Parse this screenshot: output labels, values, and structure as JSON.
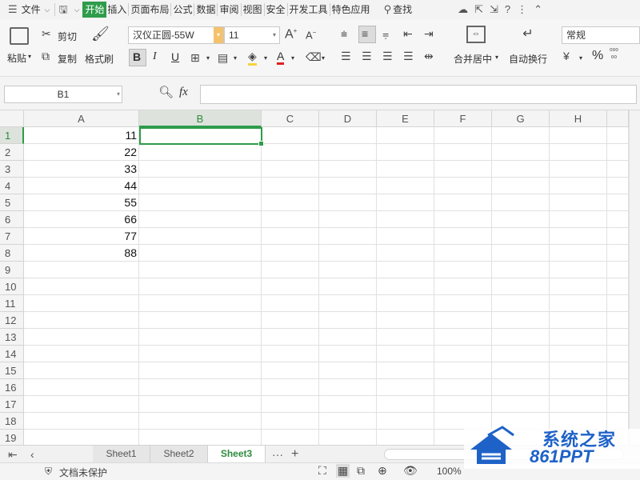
{
  "menu": {
    "file": "文件",
    "tabs": [
      "开始",
      "插入",
      "页面布局",
      "公式",
      "数据",
      "审阅",
      "视图",
      "安全",
      "开发工具",
      "特色应用"
    ],
    "active_tab": "开始",
    "search": "查找"
  },
  "ribbon": {
    "paste": "粘贴",
    "cut": "剪切",
    "copy": "复制",
    "format_painter": "格式刷",
    "font_name": "汉仪正圆-55W",
    "font_size": "11",
    "merge_center": "合并居中",
    "auto_wrap": "自动换行",
    "number_format": "常规",
    "percent": "%",
    "bold": "B",
    "italic": "I",
    "underline": "U",
    "font_color_glyph": "A"
  },
  "formula_bar": {
    "name_box": "B1",
    "fx": "fx",
    "value": ""
  },
  "grid": {
    "columns": [
      "A",
      "B",
      "C",
      "D",
      "E",
      "F",
      "G",
      "H"
    ],
    "selected_column": "B",
    "selected_row": "1",
    "rows": [
      "1",
      "2",
      "3",
      "4",
      "5",
      "6",
      "7",
      "8",
      "9",
      "10",
      "11",
      "12",
      "13",
      "14",
      "15",
      "16",
      "17",
      "18",
      "19"
    ],
    "column_a_values": [
      "11",
      "22",
      "33",
      "44",
      "55",
      "66",
      "77",
      "88"
    ]
  },
  "sheets": {
    "tabs": [
      "Sheet1",
      "Sheet2",
      "Sheet3"
    ],
    "active": "Sheet3",
    "more": "···",
    "add": "+"
  },
  "status": {
    "protect": "文档未保护",
    "zoom": "100%"
  },
  "watermark": {
    "title": "系统之家",
    "sub": "861PPT"
  },
  "colors": {
    "accent": "#2e9c4a",
    "selected_header_text": "#2e8b3d",
    "watermark_blue": "#1e62c8"
  }
}
